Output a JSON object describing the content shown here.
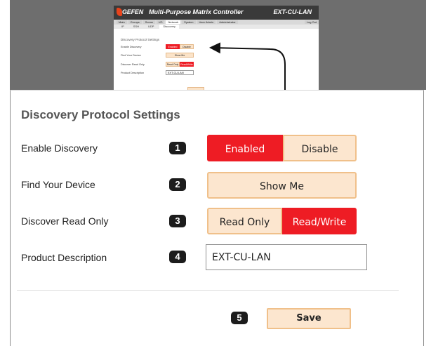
{
  "thumbnail": {
    "brand": "GEFEN",
    "app_title": "Multi-Purpose Matrix Controller",
    "model": "EXT-CU-LAN",
    "nav_tabs": [
      "Main",
      "Groups",
      "Scene",
      "I/O",
      "Network",
      "System",
      "User Admin",
      "Administrator",
      "Log Out"
    ],
    "sub_tabs": [
      "IP",
      "SSH",
      "UDP",
      "Discovery"
    ],
    "panel_title": "Discovery Protocol Settings",
    "rows": [
      "Enable Discovery",
      "Find Your Device",
      "Discover Read Only",
      "Product Description"
    ],
    "buttons": {
      "enabled": "Enabled",
      "disable": "Disable",
      "show_me": "Show Me",
      "read_only": "Read Only",
      "read_write": "Read/Write"
    },
    "product_description": "EXT-CU-LAN"
  },
  "settings": {
    "title": "Discovery Protocol Settings",
    "rows": [
      {
        "number": "1",
        "label": "Enable Discovery"
      },
      {
        "number": "2",
        "label": "Find Your Device"
      },
      {
        "number": "3",
        "label": "Discover Read Only"
      },
      {
        "number": "4",
        "label": "Product Description"
      }
    ],
    "enable_discovery": {
      "enabled_label": "Enabled",
      "disable_label": "Disable",
      "selected": "Enabled"
    },
    "find_device": {
      "show_me_label": "Show Me"
    },
    "discover_read_only": {
      "read_only_label": "Read Only",
      "read_write_label": "Read/Write",
      "selected": "Read/Write"
    },
    "product_description": {
      "value": "EXT-CU-LAN"
    },
    "save": {
      "number": "5",
      "label": "Save"
    }
  },
  "colors": {
    "accent_red": "#ee1c24",
    "button_peach": "#fce6cf",
    "button_border": "#f0c08a",
    "badge": "#1c1c1c"
  }
}
